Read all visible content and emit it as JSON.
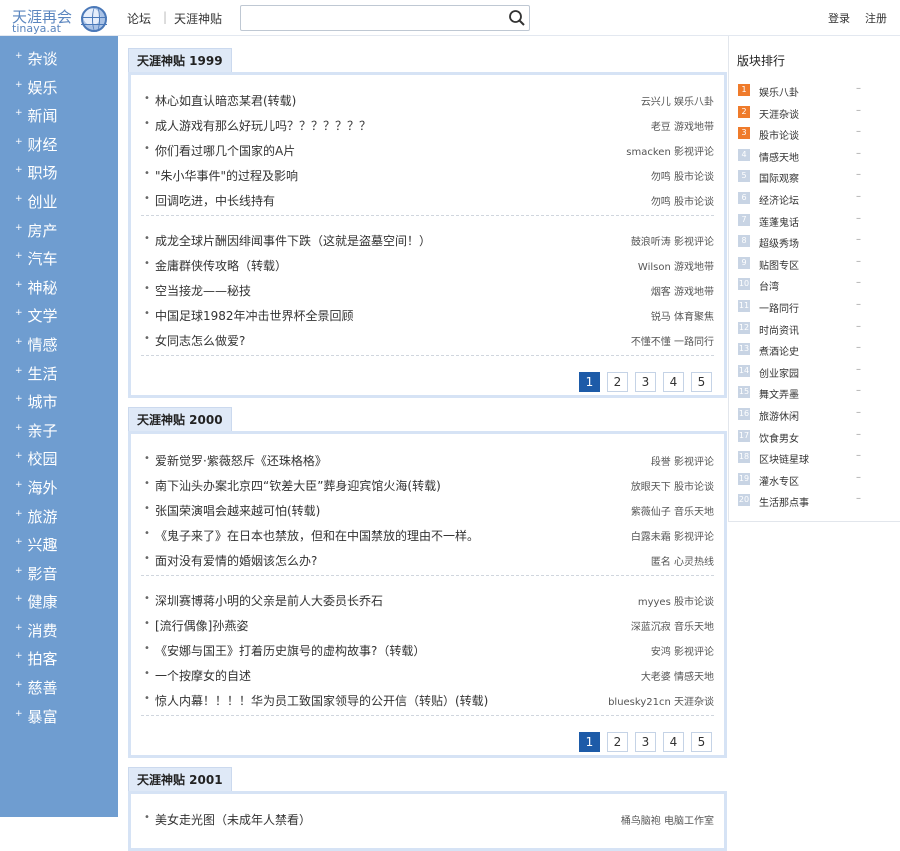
{
  "header": {
    "logo_cn": "天涯再会",
    "logo_en": "tinaya.at",
    "nav_forum": "论坛",
    "nav_sep": "|",
    "nav_tianya": "天涯神贴",
    "search_value": "",
    "login": "登录",
    "register": "注册"
  },
  "sidebar": {
    "items": [
      "杂谈",
      "娱乐",
      "新闻",
      "财经",
      "职场",
      "创业",
      "房产",
      "汽车",
      "神秘",
      "文学",
      "情感",
      "生活",
      "城市",
      "亲子",
      "校园",
      "海外",
      "旅游",
      "兴趣",
      "影音",
      "健康",
      "消费",
      "拍客",
      "慈善",
      "暴富"
    ]
  },
  "sections": [
    {
      "title": "天涯神贴 1999",
      "posts": [
        {
          "title": "林心如直认暗恋某君(转载)",
          "author": "云兴儿",
          "board": "娱乐八卦"
        },
        {
          "title": "成人游戏有那么好玩儿吗？？？？？？？",
          "author": "老豆",
          "board": "游戏地带"
        },
        {
          "title": "你们看过哪几个国家的A片",
          "author": "smacken",
          "board": "影视评论"
        },
        {
          "title": "\"朱小华事件\"的过程及影响",
          "author": "勿鸣",
          "board": "股市论谈"
        },
        {
          "title": "回调吃进，中长线持有",
          "author": "勿鸣",
          "board": "股市论谈"
        },
        {
          "title": "成龙全球片酬因绯闻事件下跌（这就是盗墓空间！）",
          "author": "鼓浪听涛",
          "board": "影视评论"
        },
        {
          "title": "金庸群侠传攻略（转载）",
          "author": "Wilson",
          "board": "游戏地带"
        },
        {
          "title": "空当接龙——秘技",
          "author": "烟客",
          "board": "游戏地带"
        },
        {
          "title": "中国足球1982年冲击世界杯全景回顾",
          "author": "锐马",
          "board": "体育聚焦"
        },
        {
          "title": "女同志怎么做爱?",
          "author": "不懂不懂",
          "board": "一路同行"
        }
      ],
      "pages": [
        "1",
        "2",
        "3",
        "4",
        "5"
      ]
    },
    {
      "title": "天涯神贴 2000",
      "posts": [
        {
          "title": "爱新觉罗·紫薇怒斥《还珠格格》",
          "author": "段誉",
          "board": "影视评论"
        },
        {
          "title": "南下汕头办案北京四“钦差大臣”葬身迎宾馆火海(转载)",
          "author": "放眼天下",
          "board": "股市论谈"
        },
        {
          "title": "张国荣演唱会越来越可怕(转载)",
          "author": "紫薇仙子",
          "board": "音乐天地"
        },
        {
          "title": "《鬼子来了》在日本也禁放，但和在中国禁放的理由不一样。",
          "author": "白露未霜",
          "board": "影视评论"
        },
        {
          "title": "面对没有爱情的婚姻该怎么办?",
          "author": "匿名",
          "board": "心灵热线"
        },
        {
          "title": "深圳赛博蒋小明的父亲是前人大委员长乔石",
          "author": "myyes",
          "board": "股市论谈"
        },
        {
          "title": "[流行偶像]孙燕姿",
          "author": "深蓝沉寂",
          "board": "音乐天地"
        },
        {
          "title": "《安娜与国王》打着历史旗号的虚构故事?（转载）",
          "author": "安鸿",
          "board": "影视评论"
        },
        {
          "title": "一个按摩女的自述",
          "author": "大老婆",
          "board": "情感天地"
        },
        {
          "title": "惊人内幕！！！！华为员工致国家领导的公开信（转贴）(转载)",
          "author": "bluesky21cn",
          "board": "天涯杂谈"
        }
      ],
      "pages": [
        "1",
        "2",
        "3",
        "4",
        "5"
      ]
    },
    {
      "title": "天涯神贴 2001",
      "posts": [
        {
          "title": "美女走光图（未成年人禁看）",
          "author": "桶鸟脑袍",
          "board": "电脑工作室"
        }
      ]
    }
  ],
  "rank": {
    "title": "版块排行",
    "items": [
      {
        "num": "1",
        "name": "娱乐八卦",
        "trend": "–"
      },
      {
        "num": "2",
        "name": "天涯杂谈",
        "trend": "–"
      },
      {
        "num": "3",
        "name": "股市论谈",
        "trend": "–"
      },
      {
        "num": "4",
        "name": "情感天地",
        "trend": "–"
      },
      {
        "num": "5",
        "name": "国际观察",
        "trend": "–"
      },
      {
        "num": "6",
        "name": "经济论坛",
        "trend": "–"
      },
      {
        "num": "7",
        "name": "莲蓬鬼话",
        "trend": "–"
      },
      {
        "num": "8",
        "name": "超级秀场",
        "trend": "–"
      },
      {
        "num": "9",
        "name": "贴图专区",
        "trend": "–"
      },
      {
        "num": "10",
        "name": "台湾",
        "trend": "–"
      },
      {
        "num": "11",
        "name": "一路同行",
        "trend": "–"
      },
      {
        "num": "12",
        "name": "时尚资讯",
        "trend": "–"
      },
      {
        "num": "13",
        "name": "煮酒论史",
        "trend": "–"
      },
      {
        "num": "14",
        "name": "创业家园",
        "trend": "–"
      },
      {
        "num": "15",
        "name": "舞文弄墨",
        "trend": "–"
      },
      {
        "num": "16",
        "name": "旅游休闲",
        "trend": "–"
      },
      {
        "num": "17",
        "name": "饮食男女",
        "trend": "–"
      },
      {
        "num": "18",
        "name": "区块链星球",
        "trend": "–"
      },
      {
        "num": "19",
        "name": "灌水专区",
        "trend": "–"
      },
      {
        "num": "20",
        "name": "生活那点事",
        "trend": "–"
      }
    ]
  },
  "colors": {
    "sidebar_bg": "#6f9dd0",
    "accent_blue": "#1d5ba8",
    "hot_rank": "#ef7b2b"
  }
}
